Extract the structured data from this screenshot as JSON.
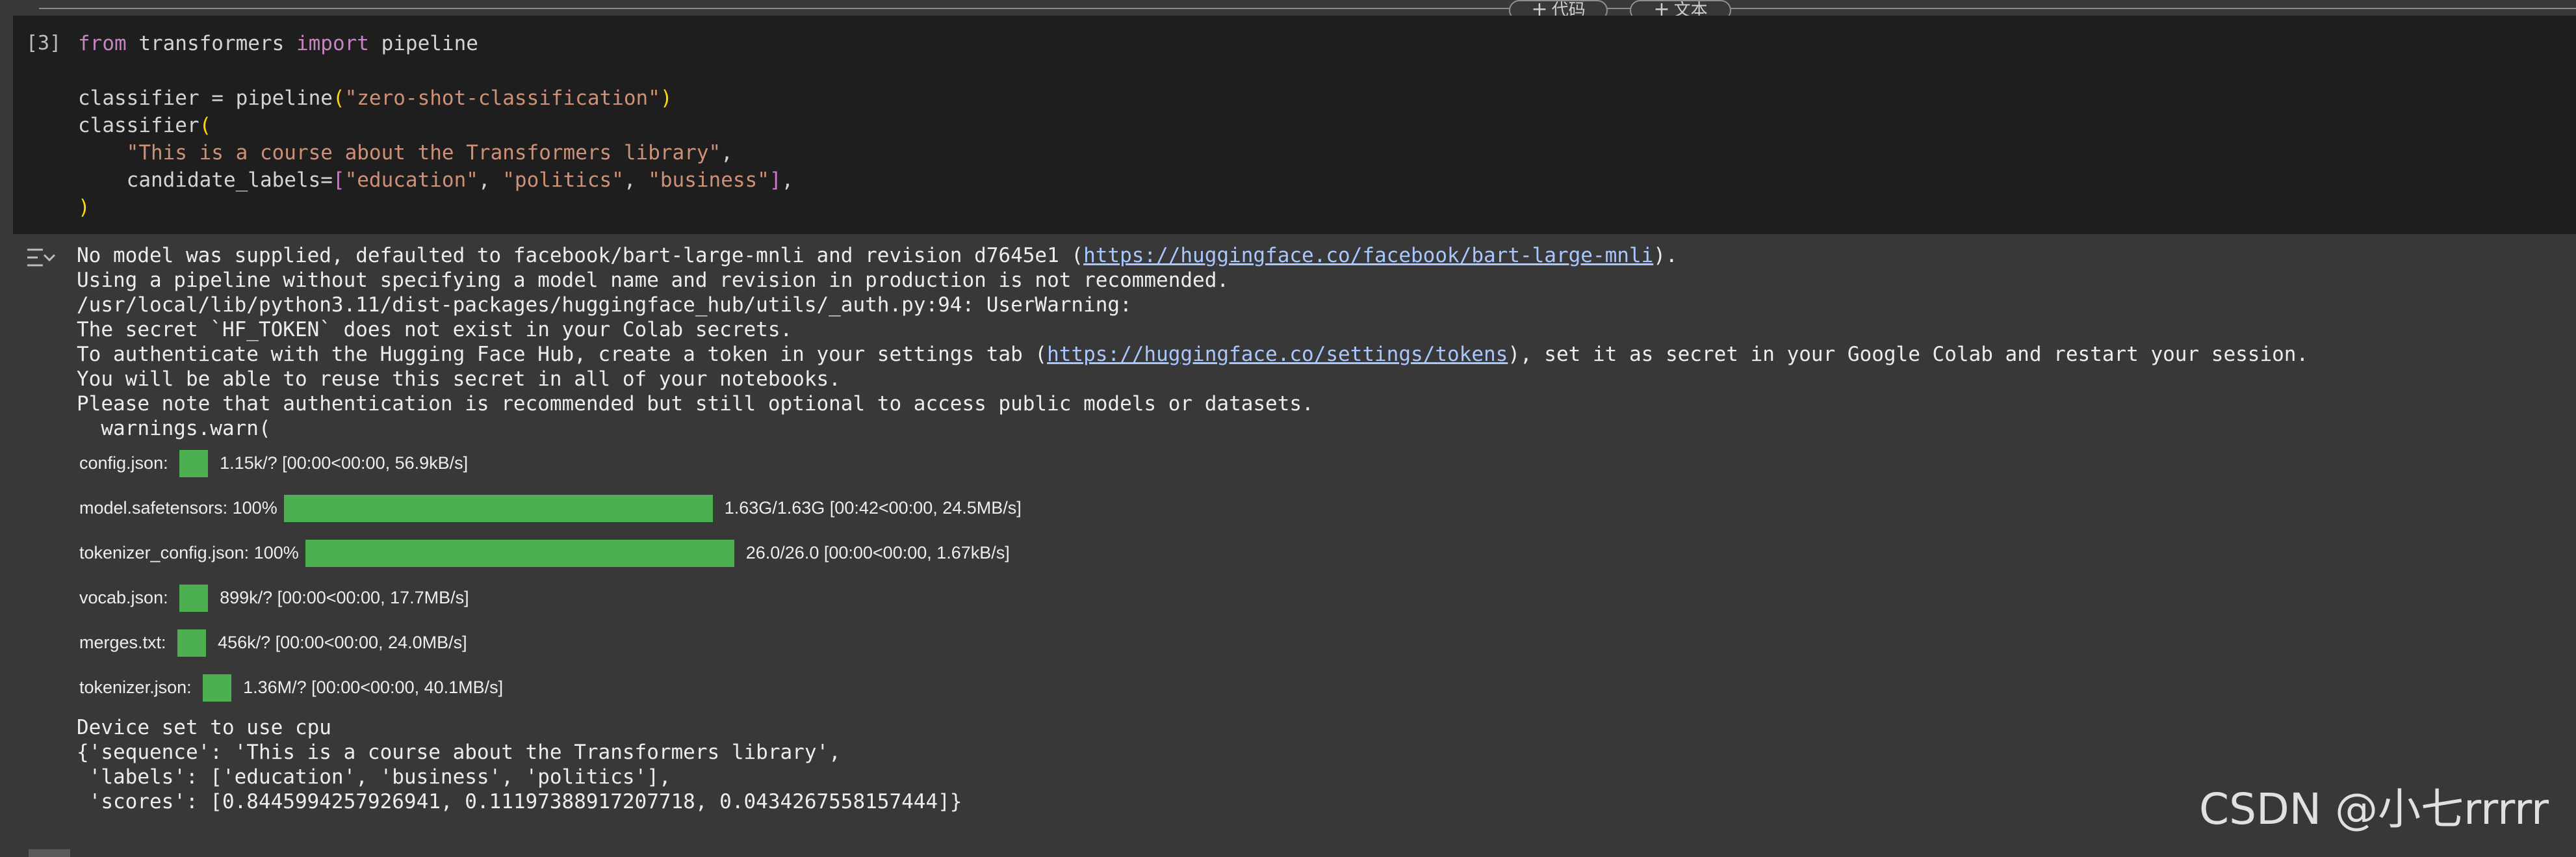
{
  "toolbar": {
    "add_code_label": "代码",
    "add_text_label": "文本"
  },
  "code_cell": {
    "execution_count": "[3]",
    "code": {
      "line1": {
        "kw1": "from",
        "mod": " transformers ",
        "kw2": "import",
        "name": " pipeline"
      },
      "line2": {
        "lhs": "classifier = pipeline",
        "open": "(",
        "arg": "\"zero-shot-classification\"",
        "close": ")"
      },
      "line3": {
        "name": "classifier",
        "open": "("
      },
      "line4": {
        "indent": "    ",
        "text": "\"This is a course about the Transformers library\"",
        "comma": ","
      },
      "line5": {
        "indent": "    ",
        "key": "candidate_labels=",
        "open": "[",
        "l1": "\"education\"",
        "sep1": ", ",
        "l2": "\"politics\"",
        "sep2": ", ",
        "l3": "\"business\"",
        "close": "]",
        "comma": ","
      },
      "line6": {
        "close": ")"
      }
    }
  },
  "output": {
    "icon": "output-toggle-icon",
    "log": {
      "line1_prefix": "No model was supplied, defaulted to facebook/bart-large-mnli and revision d7645e1 (",
      "line1_link": "https://huggingface.co/facebook/bart-large-mnli",
      "line1_suffix": ").",
      "line2": "Using a pipeline without specifying a model name and revision in production is not recommended.",
      "line3": "/usr/local/lib/python3.11/dist-packages/huggingface_hub/utils/_auth.py:94: UserWarning:",
      "line4": "The secret `HF_TOKEN` does not exist in your Colab secrets.",
      "line5_prefix": "To authenticate with the Hugging Face Hub, create a token in your settings tab (",
      "line5_link": "https://huggingface.co/settings/tokens",
      "line5_suffix": "), set it as secret in your Google Colab and restart your session.",
      "line6": "You will be able to reuse this secret in all of your notebooks.",
      "line7": "Please note that authentication is recommended but still optional to access public models or datasets.",
      "line8": "  warnings.warn("
    },
    "progress": [
      {
        "label": "config.json:",
        "percent": "",
        "fill_percent": 100,
        "bar_width_units": 44,
        "stats": "1.15k/? [00:00<00:00, 56.9kB/s]"
      },
      {
        "label": "model.safetensors:",
        "percent": "100%",
        "fill_percent": 100,
        "bar_width_units": 660,
        "stats": "1.63G/1.63G [00:42<00:00, 24.5MB/s]"
      },
      {
        "label": "tokenizer_config.json:",
        "percent": "100%",
        "fill_percent": 100,
        "bar_width_units": 660,
        "stats": "26.0/26.0 [00:00<00:00, 1.67kB/s]"
      },
      {
        "label": "vocab.json:",
        "percent": "",
        "fill_percent": 100,
        "bar_width_units": 44,
        "stats": "899k/? [00:00<00:00, 17.7MB/s]"
      },
      {
        "label": "merges.txt:",
        "percent": "",
        "fill_percent": 100,
        "bar_width_units": 44,
        "stats": "456k/? [00:00<00:00, 24.0MB/s]"
      },
      {
        "label": "tokenizer.json:",
        "percent": "",
        "fill_percent": 100,
        "bar_width_units": 44,
        "stats": "1.36M/? [00:00<00:00, 40.1MB/s]"
      }
    ],
    "result": {
      "line1": "Device set to use cpu",
      "line2": "{'sequence': 'This is a course about the Transformers library',",
      "line3": " 'labels': ['education', 'business', 'politics'],",
      "line4": " 'scores': [0.8445994257926941, 0.11197388917207718, 0.0434267558157444]}"
    }
  },
  "watermark": "CSDN @小七rrrrr"
}
